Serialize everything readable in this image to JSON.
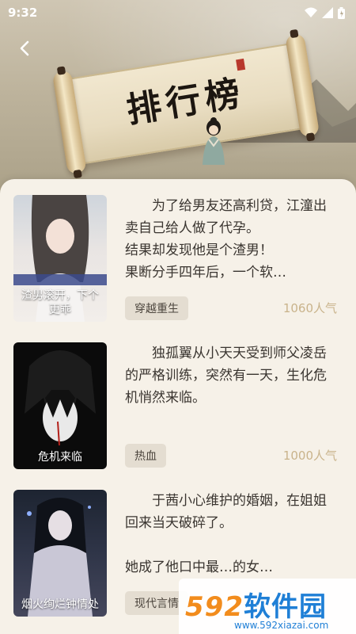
{
  "status_bar": {
    "time": "9:32"
  },
  "header": {
    "title": "排行榜",
    "back_icon": "chevron-left-icon"
  },
  "books": [
    {
      "cover_caption": "渣男滚开，下个更乖",
      "description": "为了给男友还高利贷，江潼出卖自己给人做了代孕。\n结果却发现他是个渣男！\n果断分手四年后，一个软…",
      "tag": "穿越重生",
      "popularity": "1060人气"
    },
    {
      "cover_caption": "危机来临",
      "description": "独孤翼从小天天受到师父凌岳的严格训练，突然有一天，生化危机悄然来临。",
      "tag": "热血",
      "popularity": "1000人气"
    },
    {
      "cover_caption": "烟火绚烂钟情处",
      "description": "于茜小心维护的婚姻，在姐姐回来当天破碎了。\n\n她成了他口中最…的女…",
      "tag": "现代言情",
      "popularity": ""
    }
  ],
  "watermark": {
    "brand_num": "592",
    "brand_text": "软件园",
    "url": "www.592xiazai.com"
  },
  "colors": {
    "tag_bg": "#e4ddd1",
    "popularity": "#c9b38b",
    "panel_bg": "#f6f1e8"
  }
}
